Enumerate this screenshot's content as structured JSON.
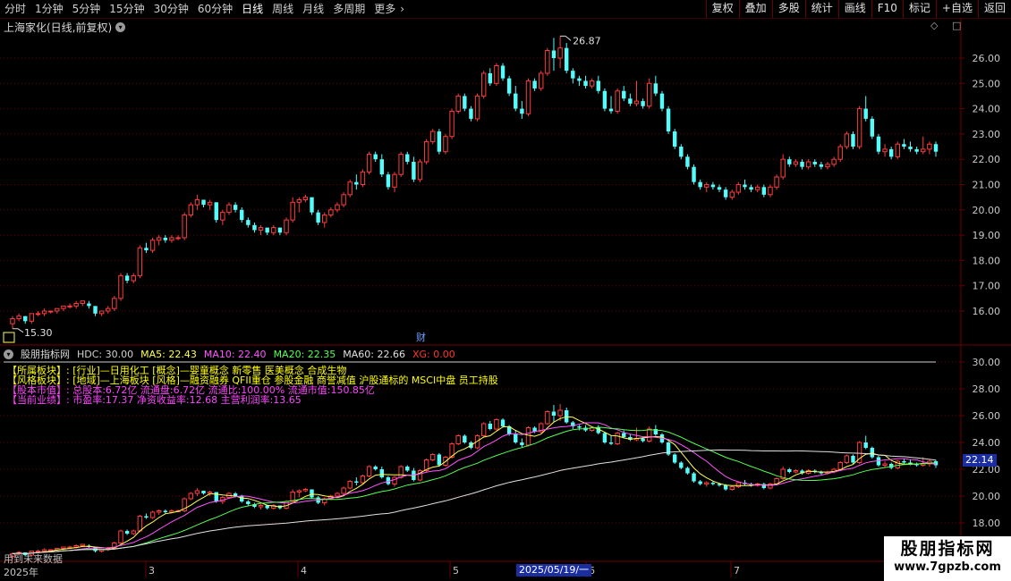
{
  "toolbar": {
    "periods": [
      "分时",
      "1分钟",
      "5分钟",
      "15分钟",
      "30分钟",
      "60分钟",
      "日线",
      "周线",
      "月线",
      "多周期",
      "更多"
    ],
    "more_chevron": "›",
    "active": "日线",
    "buttons": [
      "复权",
      "叠加",
      "多股",
      "统计",
      "画线",
      "F10",
      "标记",
      "+自选",
      "返回"
    ]
  },
  "chart_title": "上海家化(日线,前复权)",
  "right_icons": "◇ □",
  "main_chart": {
    "high_label": "26.87",
    "low_label": "15.30",
    "finance_marker": "财",
    "y_ticks": [
      "26.00",
      "25.00",
      "24.00",
      "23.00",
      "22.00",
      "21.00",
      "20.00",
      "19.00",
      "18.00",
      "17.00",
      "16.00"
    ]
  },
  "indicator": {
    "name": "股朋指标网",
    "values": [
      {
        "label": "HDC: 30.00",
        "color": "#d0d0d0"
      },
      {
        "label": "MA5: 22.43",
        "color": "#ffff55"
      },
      {
        "label": "MA10: 22.40",
        "color": "#ff55ff"
      },
      {
        "label": "MA20: 22.35",
        "color": "#55ff55"
      },
      {
        "label": "MA60: 22.66",
        "color": "#e0e0e0"
      },
      {
        "label": "XG: 0.00",
        "color": "#ff3333"
      }
    ],
    "info_lines": [
      {
        "text": "【所属板块】: [行业]—日用化工 [概念]—婴童概念 新零售 医美概念 合成生物",
        "color": "#ffff00"
      },
      {
        "text": "【风格板块】: [地域]—上海板块 [风格]—融资融券 QFII重仓 参股金融 商誉减值 沪股通标的 MSCI中盘 员工持股",
        "color": "#ffff00"
      },
      {
        "text": "【股本市值】: 总股本:6.72亿 流通盘:6.72亿 流通比:100.00% 流通市值:150.85亿",
        "color": "#ff44ff"
      },
      {
        "text": "【当前业绩】: 市盈率:17.37 净资收益率:12.68 主营利润率:13.65",
        "color": "#ff44ff"
      }
    ],
    "y_ticks": [
      "30.00",
      "28.00",
      "26.00",
      "24.00",
      "22.00",
      "20.00",
      "18.00"
    ],
    "last_value": "22.14",
    "no_data_text": "用到未来数据"
  },
  "date_axis": {
    "labels": [
      "2025年",
      "3",
      "4",
      "5",
      "6",
      "7"
    ],
    "selected": "2025/05/19/一"
  },
  "watermark": {
    "line1": "股朋指标网",
    "line2": "www.7gpzb.com"
  },
  "chart_data": {
    "type": "candlestick",
    "title": "上海家化(日线,前复权)",
    "ylim": [
      15.0,
      27.0
    ],
    "indicator_ylim": [
      17.0,
      31.0
    ],
    "ohlc": [
      [
        15.5,
        15.8,
        15.3,
        15.7
      ],
      [
        15.7,
        15.9,
        15.6,
        15.8
      ],
      [
        15.8,
        15.8,
        15.5,
        15.6
      ],
      [
        15.6,
        15.9,
        15.5,
        15.9
      ],
      [
        15.9,
        16.0,
        15.8,
        15.9
      ],
      [
        15.9,
        16.1,
        15.8,
        16.0
      ],
      [
        16.0,
        16.0,
        15.9,
        16.0
      ],
      [
        16.0,
        16.1,
        15.9,
        16.1
      ],
      [
        16.1,
        16.2,
        16.0,
        16.2
      ],
      [
        16.2,
        16.3,
        16.1,
        16.2
      ],
      [
        16.2,
        16.4,
        16.1,
        16.3
      ],
      [
        16.3,
        16.4,
        16.2,
        16.4
      ],
      [
        16.3,
        16.4,
        16.1,
        16.2
      ],
      [
        16.2,
        16.2,
        15.8,
        15.9
      ],
      [
        15.9,
        16.0,
        15.8,
        16.0
      ],
      [
        16.0,
        16.2,
        15.9,
        16.1
      ],
      [
        16.1,
        16.6,
        16.0,
        16.5
      ],
      [
        16.5,
        17.5,
        16.4,
        17.4
      ],
      [
        17.4,
        17.5,
        17.1,
        17.2
      ],
      [
        17.2,
        17.5,
        17.1,
        17.4
      ],
      [
        17.4,
        18.6,
        17.3,
        18.5
      ],
      [
        18.5,
        18.7,
        18.3,
        18.4
      ],
      [
        18.4,
        18.9,
        18.3,
        18.8
      ],
      [
        18.8,
        19.0,
        18.6,
        18.9
      ],
      [
        18.9,
        19.0,
        18.7,
        18.8
      ],
      [
        18.8,
        19.0,
        18.7,
        18.9
      ],
      [
        18.9,
        19.0,
        18.8,
        18.9
      ],
      [
        18.9,
        19.9,
        18.8,
        19.8
      ],
      [
        19.8,
        20.3,
        19.7,
        20.2
      ],
      [
        20.2,
        20.6,
        20.0,
        20.4
      ],
      [
        20.4,
        20.4,
        20.1,
        20.2
      ],
      [
        20.2,
        20.4,
        20.0,
        20.3
      ],
      [
        20.3,
        20.3,
        19.5,
        19.6
      ],
      [
        19.6,
        20.0,
        19.4,
        19.9
      ],
      [
        19.9,
        20.3,
        19.8,
        20.2
      ],
      [
        20.2,
        20.3,
        19.9,
        20.0
      ],
      [
        20.0,
        20.1,
        19.5,
        19.6
      ],
      [
        19.6,
        19.7,
        19.3,
        19.4
      ],
      [
        19.4,
        19.5,
        19.1,
        19.2
      ],
      [
        19.2,
        19.4,
        19.0,
        19.3
      ],
      [
        19.3,
        19.3,
        19.0,
        19.1
      ],
      [
        19.1,
        19.4,
        19.0,
        19.3
      ],
      [
        19.3,
        19.3,
        19.0,
        19.1
      ],
      [
        19.1,
        19.7,
        19.0,
        19.6
      ],
      [
        19.6,
        20.5,
        19.5,
        20.3
      ],
      [
        20.3,
        20.5,
        19.9,
        20.4
      ],
      [
        20.4,
        20.6,
        20.3,
        20.5
      ],
      [
        20.5,
        20.5,
        19.8,
        19.9
      ],
      [
        19.9,
        20.0,
        19.4,
        19.5
      ],
      [
        19.5,
        19.9,
        19.3,
        19.8
      ],
      [
        19.8,
        20.1,
        19.7,
        20.0
      ],
      [
        20.0,
        20.3,
        19.9,
        20.2
      ],
      [
        20.2,
        20.7,
        20.1,
        20.6
      ],
      [
        20.6,
        21.2,
        20.5,
        21.1
      ],
      [
        21.1,
        21.4,
        20.8,
        21.0
      ],
      [
        21.0,
        21.6,
        20.9,
        21.5
      ],
      [
        21.5,
        22.3,
        21.4,
        22.2
      ],
      [
        22.2,
        22.3,
        21.9,
        22.0
      ],
      [
        22.0,
        22.2,
        21.3,
        21.4
      ],
      [
        21.4,
        21.5,
        20.8,
        20.9
      ],
      [
        20.9,
        21.5,
        20.7,
        21.4
      ],
      [
        21.4,
        22.3,
        21.3,
        22.2
      ],
      [
        22.2,
        22.3,
        21.8,
        21.9
      ],
      [
        21.9,
        22.1,
        21.1,
        21.2
      ],
      [
        21.2,
        22.0,
        21.1,
        21.9
      ],
      [
        21.9,
        22.8,
        21.8,
        22.7
      ],
      [
        22.7,
        23.2,
        22.6,
        23.1
      ],
      [
        23.1,
        23.2,
        22.2,
        22.3
      ],
      [
        22.3,
        23.0,
        22.2,
        22.9
      ],
      [
        22.9,
        24.0,
        22.8,
        23.9
      ],
      [
        23.9,
        24.6,
        23.8,
        24.5
      ],
      [
        24.5,
        24.6,
        23.9,
        24.0
      ],
      [
        24.0,
        24.1,
        23.5,
        23.6
      ],
      [
        23.6,
        24.6,
        23.5,
        24.5
      ],
      [
        24.5,
        25.5,
        24.4,
        25.4
      ],
      [
        25.4,
        25.6,
        24.9,
        25.0
      ],
      [
        25.0,
        25.8,
        24.9,
        25.7
      ],
      [
        25.7,
        25.8,
        25.1,
        25.2
      ],
      [
        25.2,
        25.3,
        24.5,
        24.6
      ],
      [
        24.6,
        24.9,
        23.9,
        24.0
      ],
      [
        24.0,
        24.3,
        23.6,
        23.8
      ],
      [
        23.8,
        25.2,
        23.7,
        25.1
      ],
      [
        25.1,
        25.2,
        24.7,
        24.8
      ],
      [
        24.8,
        25.5,
        24.7,
        25.4
      ],
      [
        25.4,
        26.4,
        25.3,
        26.3
      ],
      [
        26.3,
        26.8,
        25.5,
        26.0
      ],
      [
        26.0,
        26.87,
        25.6,
        26.4
      ],
      [
        26.4,
        26.6,
        25.4,
        25.5
      ],
      [
        25.5,
        25.6,
        25.0,
        25.2
      ],
      [
        25.2,
        25.3,
        24.9,
        25.1
      ],
      [
        25.1,
        25.3,
        24.8,
        24.9
      ],
      [
        24.9,
        25.2,
        24.8,
        25.1
      ],
      [
        25.1,
        25.3,
        24.6,
        24.7
      ],
      [
        24.7,
        24.8,
        23.9,
        24.0
      ],
      [
        24.0,
        24.5,
        23.8,
        23.9
      ],
      [
        23.9,
        24.8,
        23.8,
        24.7
      ],
      [
        24.7,
        24.9,
        24.3,
        24.4
      ],
      [
        24.4,
        24.6,
        24.1,
        24.2
      ],
      [
        24.2,
        25.1,
        24.1,
        24.3
      ],
      [
        24.3,
        24.4,
        24.0,
        24.1
      ],
      [
        24.1,
        25.2,
        24.0,
        25.0
      ],
      [
        25.0,
        25.3,
        24.5,
        24.6
      ],
      [
        24.6,
        24.7,
        23.9,
        24.0
      ],
      [
        24.0,
        24.1,
        23.0,
        23.1
      ],
      [
        23.1,
        23.2,
        22.4,
        22.5
      ],
      [
        22.5,
        22.6,
        22.0,
        22.1
      ],
      [
        22.1,
        22.2,
        21.6,
        21.7
      ],
      [
        21.7,
        21.8,
        21.0,
        21.1
      ],
      [
        21.1,
        21.2,
        20.8,
        20.9
      ],
      [
        20.9,
        21.1,
        20.7,
        21.0
      ],
      [
        21.0,
        21.1,
        20.8,
        20.9
      ],
      [
        20.9,
        21.0,
        20.7,
        20.8
      ],
      [
        20.8,
        20.9,
        20.4,
        20.5
      ],
      [
        20.5,
        20.8,
        20.4,
        20.7
      ],
      [
        20.7,
        21.1,
        20.6,
        21.0
      ],
      [
        21.0,
        21.2,
        20.8,
        20.9
      ],
      [
        20.9,
        21.0,
        20.7,
        20.8
      ],
      [
        20.8,
        21.0,
        20.7,
        20.9
      ],
      [
        20.9,
        21.0,
        20.5,
        20.6
      ],
      [
        20.6,
        21.0,
        20.5,
        20.9
      ],
      [
        20.9,
        21.4,
        20.8,
        21.3
      ],
      [
        21.3,
        22.2,
        21.2,
        22.0
      ],
      [
        22.0,
        22.1,
        21.7,
        21.8
      ],
      [
        21.8,
        22.0,
        21.7,
        21.9
      ],
      [
        21.9,
        22.0,
        21.6,
        21.7
      ],
      [
        21.7,
        22.0,
        21.6,
        21.9
      ],
      [
        21.9,
        22.0,
        21.7,
        21.8
      ],
      [
        21.8,
        21.9,
        21.6,
        21.7
      ],
      [
        21.7,
        21.9,
        21.6,
        21.8
      ],
      [
        21.8,
        22.1,
        21.7,
        22.0
      ],
      [
        22.0,
        22.6,
        21.9,
        22.5
      ],
      [
        22.5,
        23.1,
        22.4,
        23.0
      ],
      [
        23.0,
        23.1,
        22.4,
        22.5
      ],
      [
        22.5,
        24.1,
        22.4,
        24.0
      ],
      [
        24.0,
        24.5,
        23.5,
        23.6
      ],
      [
        23.6,
        23.7,
        22.8,
        22.9
      ],
      [
        22.9,
        23.0,
        22.2,
        22.3
      ],
      [
        22.3,
        22.6,
        22.1,
        22.4
      ],
      [
        22.4,
        22.5,
        22.0,
        22.1
      ],
      [
        22.1,
        22.7,
        22.0,
        22.6
      ],
      [
        22.6,
        22.8,
        22.4,
        22.5
      ],
      [
        22.5,
        22.7,
        22.3,
        22.4
      ],
      [
        22.4,
        22.5,
        22.2,
        22.3
      ],
      [
        22.3,
        22.9,
        22.2,
        22.4
      ],
      [
        22.4,
        22.7,
        22.2,
        22.6
      ],
      [
        22.6,
        22.7,
        22.1,
        22.3
      ]
    ],
    "series": [
      {
        "name": "MA5",
        "color": "#ffff55",
        "period": 5
      },
      {
        "name": "MA10",
        "color": "#ff55ff",
        "period": 10
      },
      {
        "name": "MA20",
        "color": "#55ff55",
        "period": 20
      },
      {
        "name": "MA60",
        "color": "#e0e0e0",
        "period": 60
      },
      {
        "name": "HDC",
        "color": "#d0d0d0",
        "value": 30.0
      }
    ],
    "colors": {
      "up": "#ff3c3c",
      "down": "#54fcfc",
      "grid": "#6e0000",
      "axis_text": "#c8c8c8"
    },
    "grid": true
  }
}
